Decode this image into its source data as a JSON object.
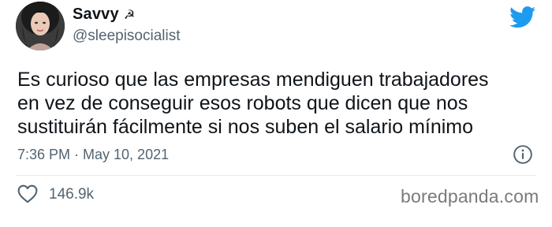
{
  "tweet": {
    "display_name": "Savvy",
    "name_emoji": "☭",
    "handle": "@sleepisocialist",
    "text": "Es curioso que las empresas mendiguen trabajadores\nen vez de conseguir esos robots que dicen que nos\nsustituirán fácilmente si nos suben el salario mínimo",
    "timestamp": "7:36 PM · May 10, 2021",
    "like_count": "146.9k"
  },
  "icons": {
    "brand": "twitter-bird-icon",
    "info": "info-icon",
    "like": "heart-icon"
  },
  "watermark": "boredpanda.com",
  "colors": {
    "twitter_blue": "#1d9bf0",
    "text_primary": "#0f1419",
    "text_secondary": "#536471"
  }
}
